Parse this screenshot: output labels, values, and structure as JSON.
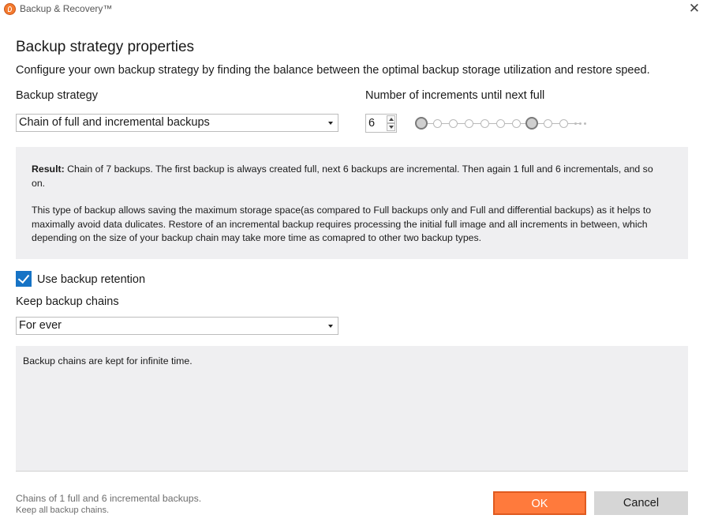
{
  "window": {
    "title": "Backup & Recovery™",
    "close_glyph": "✕"
  },
  "page": {
    "title": "Backup strategy properties",
    "description": "Configure your own backup strategy by finding the balance between the optimal backup storage utilization and restore speed."
  },
  "strategy": {
    "label": "Backup strategy",
    "selected": "Chain of full and incremental backups"
  },
  "increments": {
    "label": "Number of increments until next full",
    "value": "6",
    "track": {
      "total_dots": 10,
      "full_positions": [
        0,
        7
      ],
      "more_indicator": "..."
    }
  },
  "result_panel": {
    "result_label": "Result:",
    "result_text": " Chain of 7 backups. The first backup is always created full, next 6 backups are incremental. Then again 1 full and 6 incrementals, and so on.",
    "explanation": "This type of backup allows saving the maximum storage space(as compared to Full backups only and Full and differential backups) as it helps to maximally avoid data dulicates. Restore of an incremental backup requires processing the initial full image and all increments in between, which depending on the size of your backup chain may take more time as comapred to other two backup types."
  },
  "retention": {
    "checkbox_label": "Use backup retention",
    "checked": true,
    "keep_label": "Keep backup chains",
    "keep_selected": "For ever",
    "info_text": "Backup chains are kept for infinite time."
  },
  "footer": {
    "summary_line1": "Chains of 1 full and 6 incremental backups.",
    "summary_line2": "Keep all backup chains.",
    "ok_label": "OK",
    "cancel_label": "Cancel"
  },
  "colors": {
    "accent": "#ff7a3c",
    "checkbox": "#1673c5",
    "panel_bg": "#efeff1"
  }
}
